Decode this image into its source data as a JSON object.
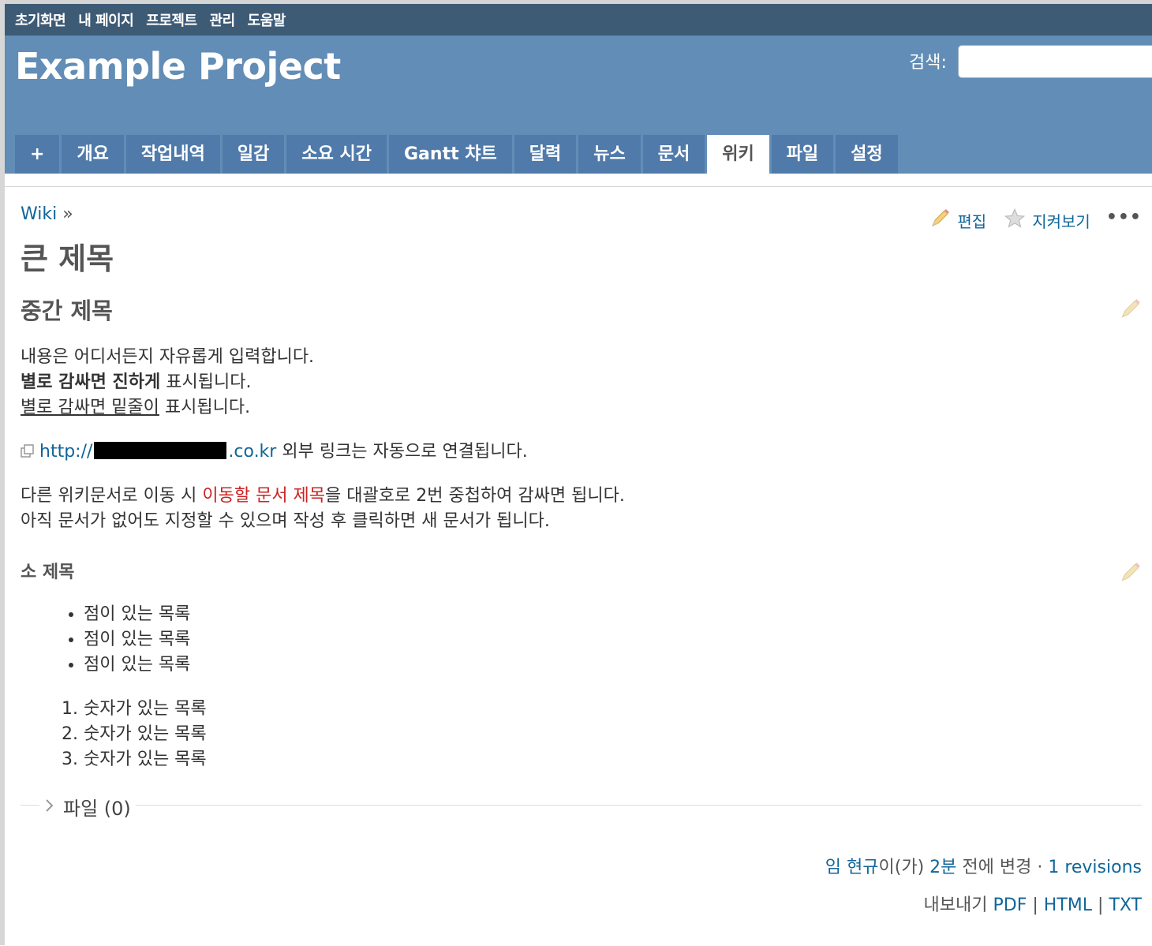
{
  "top_menu": {
    "items": [
      "초기화면",
      "내 페이지",
      "프로젝트",
      "관리",
      "도움말"
    ]
  },
  "header": {
    "title": "Example Project",
    "search_label": "검색:",
    "search_value": ""
  },
  "tabs": [
    {
      "label": "+",
      "selected": false
    },
    {
      "label": "개요",
      "selected": false
    },
    {
      "label": "작업내역",
      "selected": false
    },
    {
      "label": "일감",
      "selected": false
    },
    {
      "label": "소요 시간",
      "selected": false
    },
    {
      "label": "Gantt 챠트",
      "selected": false
    },
    {
      "label": "달력",
      "selected": false
    },
    {
      "label": "뉴스",
      "selected": false
    },
    {
      "label": "문서",
      "selected": false
    },
    {
      "label": "위키",
      "selected": true
    },
    {
      "label": "파일",
      "selected": false
    },
    {
      "label": "설정",
      "selected": false
    }
  ],
  "breadcrumb": {
    "link": "Wiki",
    "separator": "»"
  },
  "contextual": {
    "edit": "편집",
    "watch": "지켜보기",
    "more": "•••"
  },
  "page": {
    "h1": "큰 제목",
    "h2": "중간 제목",
    "p1_line1": "내용은 어디서든지 자유롭게 입력합니다.",
    "p1_bold": "별로 감싸면 진하게",
    "p1_bold_suffix": " 표시됩니다.",
    "p1_underline": "별로 감싸면 밑줄이",
    "p1_underline_suffix": " 표시됩니다.",
    "ext_link_prefix": "http://",
    "ext_link_suffix": ".co.kr",
    "ext_text": " 외부 링크는 자동으로 연결됩니다.",
    "p3_prefix": "다른 위키문서로 이동 시 ",
    "p3_link": "이동할 문서 제목",
    "p3_suffix": "을 대괄호로 2번 중첩하여 감싸면 됩니다.",
    "p3_line2": "아직 문서가 없어도 지정할 수 있으며 작성 후 클릭하면 새 문서가 됩니다.",
    "h3": "소 제목",
    "bullets": [
      "점이 있는 목록",
      "점이 있는 목록",
      "점이 있는 목록"
    ],
    "numbered": [
      "숫자가 있는 목록",
      "숫자가 있는 목록",
      "숫자가 있는 목록"
    ]
  },
  "attachments": {
    "label": "파일 (0)"
  },
  "updated": {
    "author": "임 현규",
    "author_suffix": "이(가) ",
    "time": "2분",
    "time_suffix": " 전에 변경 · ",
    "revisions": "1 revisions"
  },
  "export": {
    "label": "내보내기",
    "pdf": "PDF",
    "html": "HTML",
    "txt": "TXT",
    "sep": "|"
  }
}
